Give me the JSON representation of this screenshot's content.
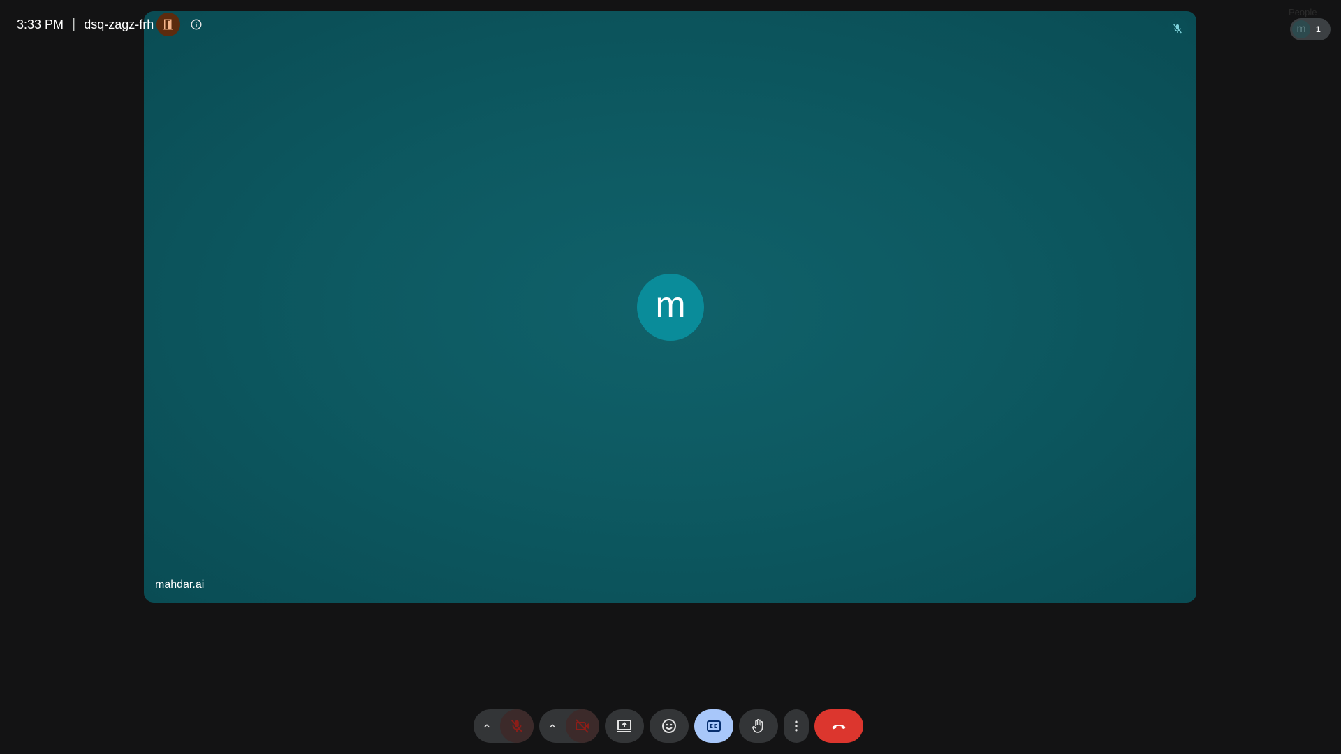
{
  "meeting": {
    "time": "3:33 PM",
    "separator": "|",
    "code": "dsq-zagz-frh"
  },
  "tile": {
    "participant_name": "mahdar.ai",
    "avatar_initial": "m",
    "avatar_color": "#0a8c9a"
  },
  "people": {
    "label": "People",
    "avatar_initial": "m",
    "count": "1"
  },
  "colors": {
    "background": "#131314",
    "tile": "#0d5961",
    "end_call": "#dc362e",
    "captions_active": "#a8c7fa",
    "muted_red": "#e46962"
  },
  "controls": {
    "icons": [
      "caret-up-icon",
      "mic-off-icon",
      "caret-up-icon",
      "camera-off-icon",
      "present-icon",
      "emoji-icon",
      "captions-icon",
      "raise-hand-icon",
      "more-vert-icon",
      "end-call-icon"
    ]
  }
}
